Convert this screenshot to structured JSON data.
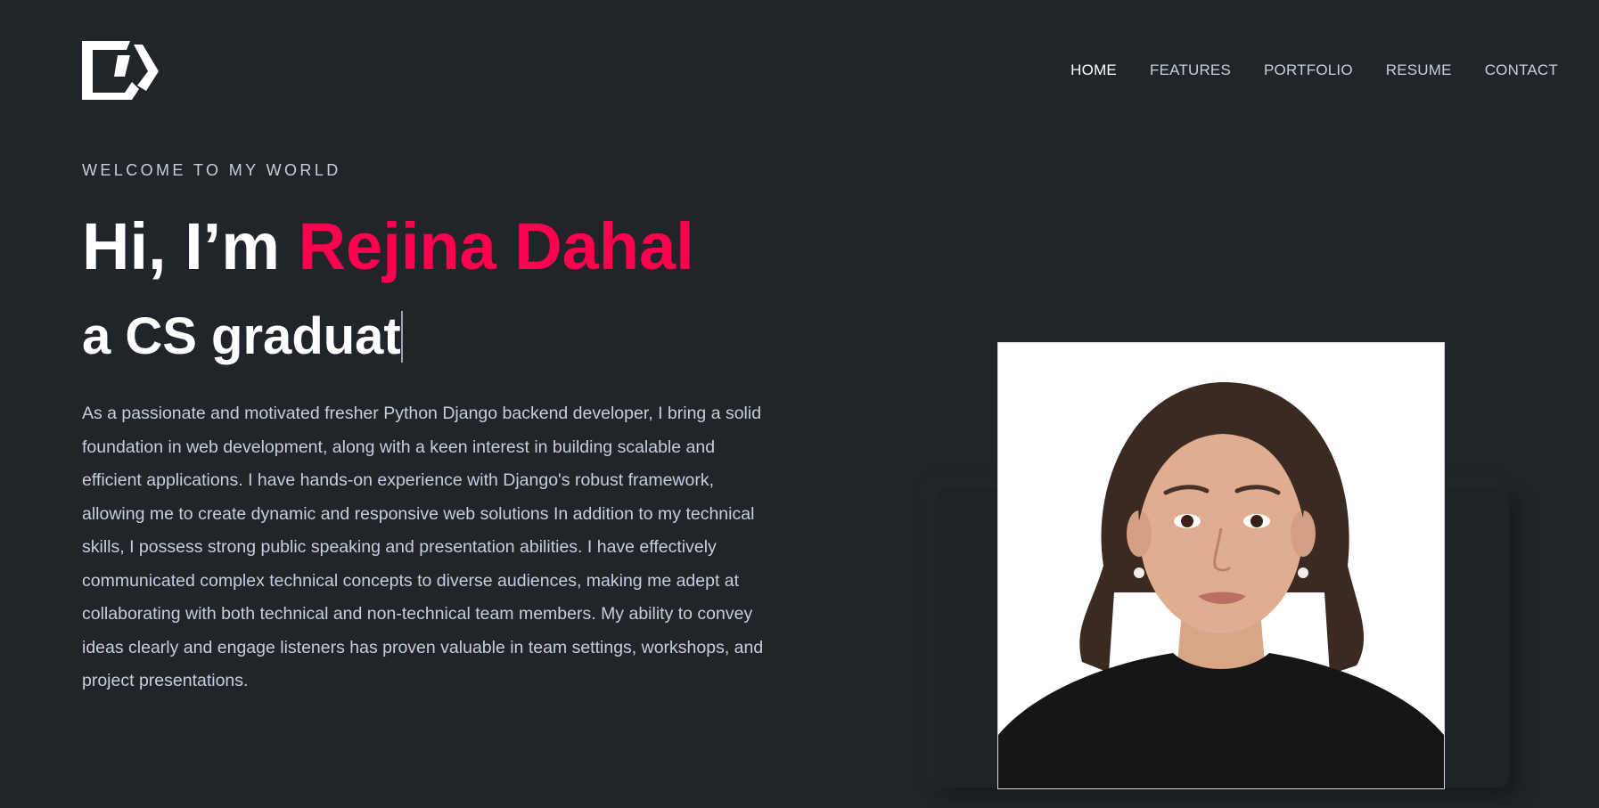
{
  "header": {
    "logo_icon": "brand-logo-icon",
    "nav": [
      {
        "label": "HOME",
        "active": true
      },
      {
        "label": "FEATURES",
        "active": false
      },
      {
        "label": "PORTFOLIO",
        "active": false
      },
      {
        "label": "RESUME",
        "active": false
      },
      {
        "label": "CONTACT",
        "active": false
      }
    ]
  },
  "hero": {
    "welcome": "WELCOME TO MY WORLD",
    "greeting": "Hi, I’m ",
    "name": "Rejina Dahal",
    "typed_text": "a CS graduat",
    "bio": "As a passionate and motivated fresher Python Django backend developer, I bring a solid foundation in web development, along with a keen interest in building scalable and efficient applications. I have hands-on experience with Django's robust framework, allowing me to create dynamic and responsive web solutions In addition to my technical skills, I possess strong public speaking and presentation abilities. I have effectively communicated complex technical concepts to diverse audiences, making me adept at collaborating with both technical and non-technical team members. My ability to convey ideas clearly and engage listeners has proven valuable in team settings, workshops, and project presentations.",
    "photo_icon": "profile-portrait-icon"
  },
  "colors": {
    "background": "#212428",
    "accent": "#ff014f",
    "text_muted": "#c4cfde",
    "text_bright": "#ffffff"
  }
}
